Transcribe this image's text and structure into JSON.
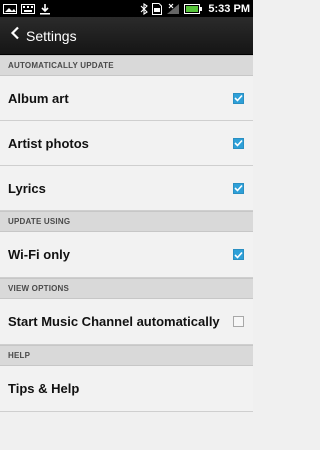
{
  "status_bar": {
    "time": "5:33",
    "period": "PM",
    "left_icons": [
      "photo-notification-icon",
      "keyboard-icon",
      "download-icon"
    ],
    "right_icons": [
      "bluetooth-icon",
      "sim-icon",
      "no-signal-icon",
      "battery-icon"
    ]
  },
  "action_bar": {
    "title": "Settings",
    "back_icon": "chevron-left-icon"
  },
  "sections": [
    {
      "header": "AUTOMATICALLY UPDATE",
      "items": [
        {
          "label": "Album art",
          "checked": true
        },
        {
          "label": "Artist photos",
          "checked": true
        },
        {
          "label": "Lyrics",
          "checked": true
        }
      ]
    },
    {
      "header": "UPDATE USING",
      "items": [
        {
          "label": "Wi-Fi only",
          "checked": true
        }
      ]
    },
    {
      "header": "VIEW OPTIONS",
      "items": [
        {
          "label": "Start Music Channel automatically",
          "checked": false
        }
      ]
    },
    {
      "header": "HELP",
      "items": [
        {
          "label": "Tips & Help",
          "checked": null
        }
      ]
    }
  ],
  "colors": {
    "accent": "#2ea0d8",
    "action_bar": "#1f1f1f",
    "section_header": "#d9d9d9",
    "background": "#f0f0f0"
  }
}
